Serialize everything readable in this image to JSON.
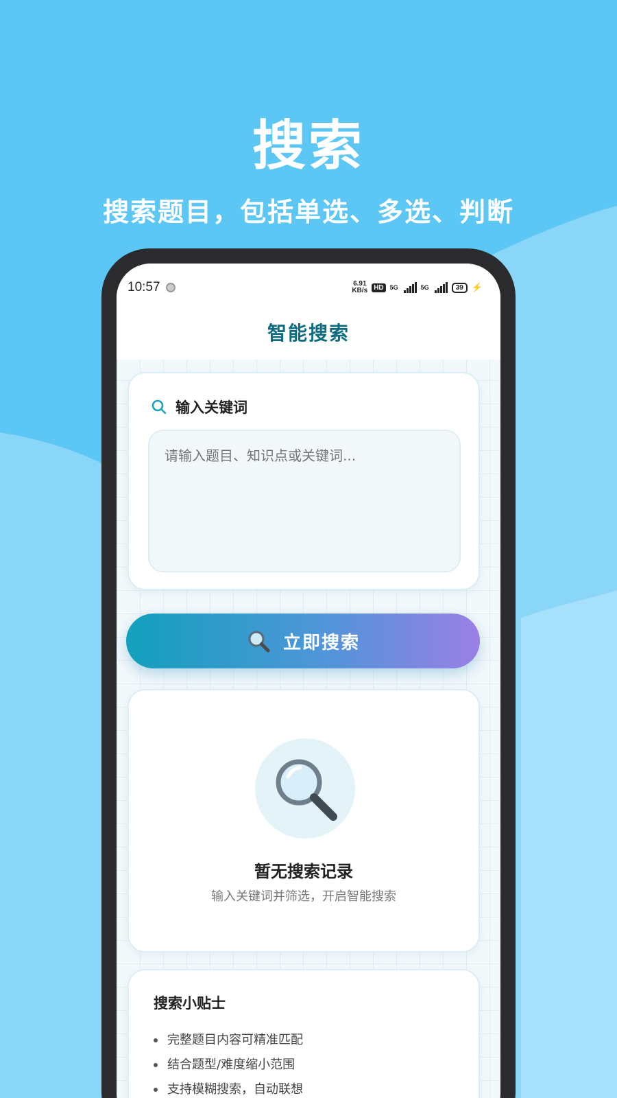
{
  "promo": {
    "title": "搜索",
    "subtitle": "搜索题目，包括单选、多选、判断"
  },
  "status_bar": {
    "time": "10:57",
    "speed_value": "6.91",
    "speed_unit": "KB/s",
    "hd": "HD",
    "net1": "5G",
    "net2": "5G",
    "battery": "39"
  },
  "header": {
    "title": "智能搜索"
  },
  "search": {
    "label": "输入关键词",
    "placeholder": "请输入题目、知识点或关键词...",
    "value": "",
    "button_label": "立即搜索"
  },
  "empty_state": {
    "title": "暂无搜索记录",
    "subtitle": "输入关键词并筛选，开启智能搜索"
  },
  "tips": {
    "title": "搜索小贴士",
    "items": [
      "完整题目内容可精准匹配",
      "结合题型/难度缩小范围",
      "支持模糊搜索，自动联想"
    ]
  },
  "colors": {
    "background": "#5cc6f5",
    "header_title": "#0d6c80",
    "button_start": "#13a0bd",
    "button_end": "#9b7fe6"
  }
}
